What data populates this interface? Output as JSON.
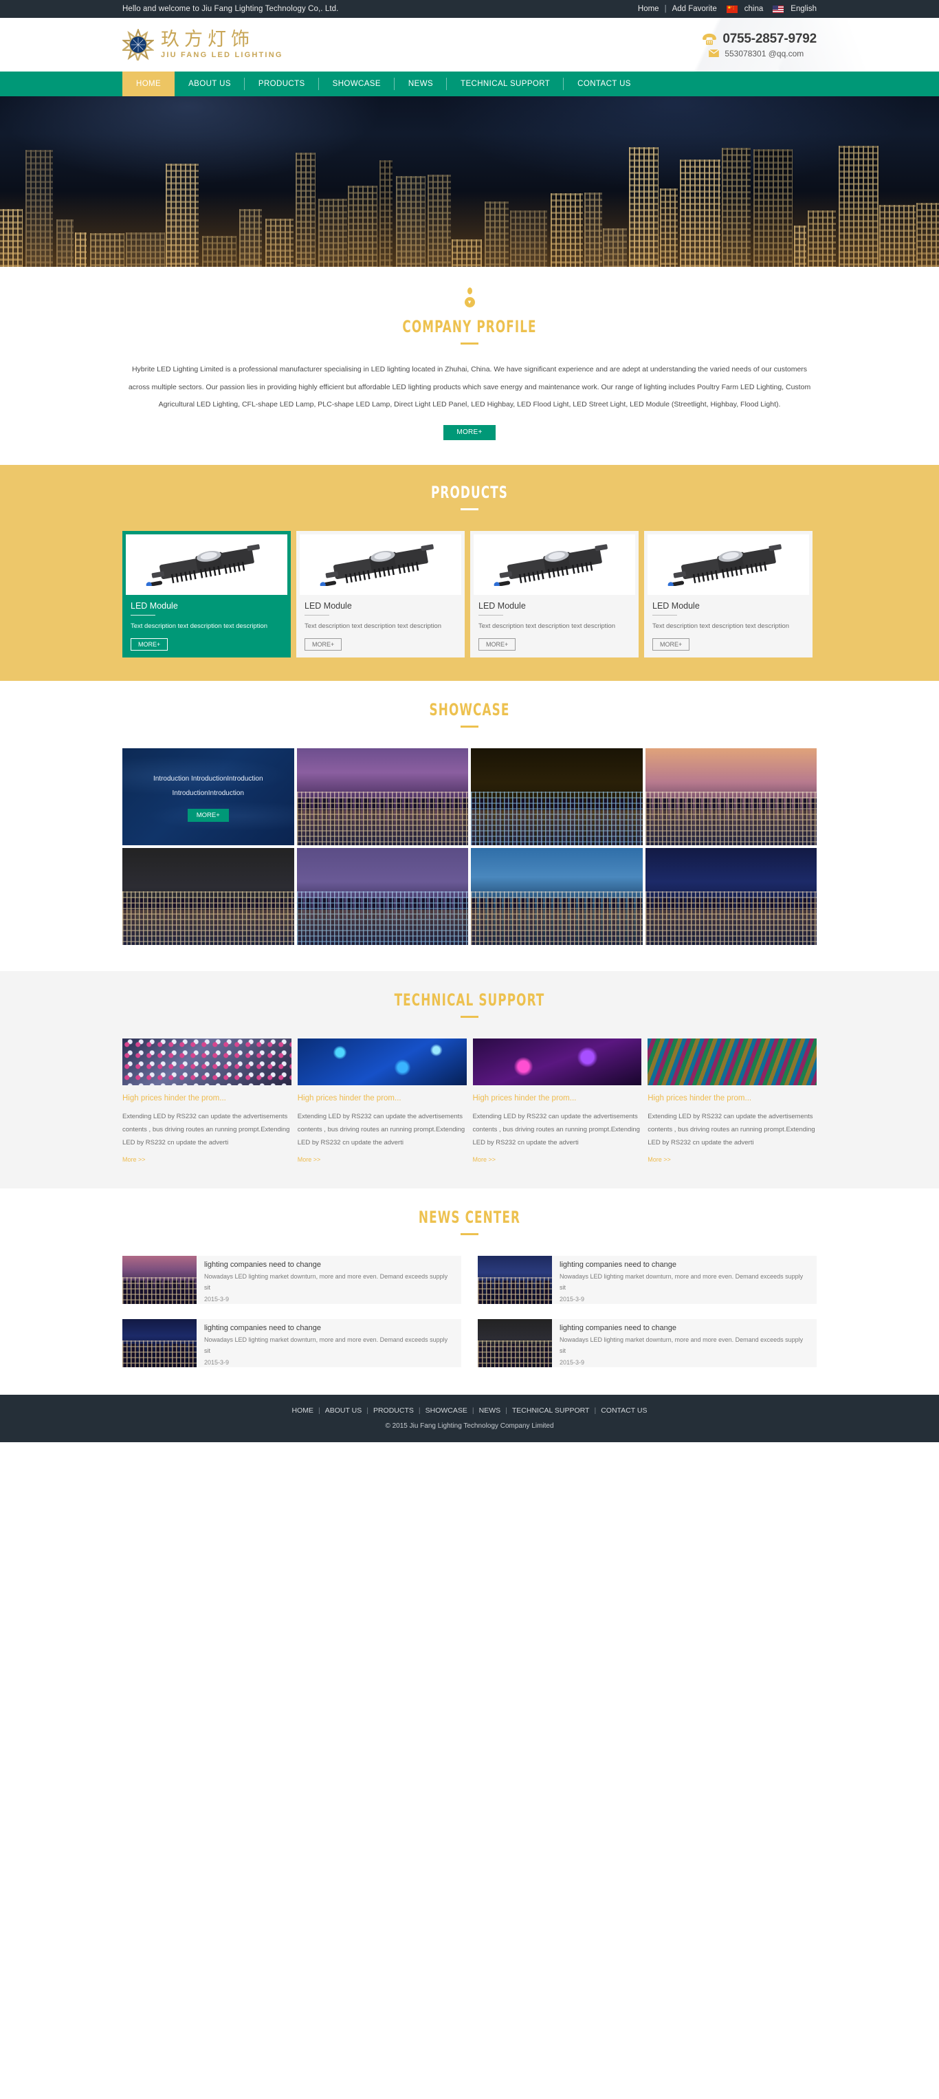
{
  "topbar": {
    "welcome": "Hello and welcome to Jiu Fang Lighting Technology Co,. Ltd.",
    "home": "Home",
    "separator": "|",
    "add_favorite": "Add Favorite",
    "lang_cn": "china",
    "lang_en": "English"
  },
  "header": {
    "logo_cn": "玖方灯饰",
    "logo_en": "JIU FANG LED LIGHTING",
    "phone": "0755-2857-9792",
    "email": "553078301 @qq.com"
  },
  "nav": {
    "items": [
      {
        "label": "HOME",
        "active": true
      },
      {
        "label": "ABOUT US",
        "active": false
      },
      {
        "label": "PRODUCTS",
        "active": false
      },
      {
        "label": "SHOWCASE",
        "active": false
      },
      {
        "label": "NEWS",
        "active": false
      },
      {
        "label": "TECHNICAL SUPPORT",
        "active": false
      },
      {
        "label": "CONTACT US",
        "active": false
      }
    ]
  },
  "profile": {
    "title": "COMPANY PROFILE",
    "body": "Hybrite LED Lighting Limited is a professional manufacturer specialising in LED lighting located in Zhuhai, China. We have significant experience and are adept at understanding the varied needs of our customers across multiple sectors. Our passion lies in providing highly efficient but affordable LED lighting products which save energy and maintenance work. Our range of lighting includes  Poultry Farm LED Lighting, Custom Agricultural LED Lighting, CFL-shape LED Lamp, PLC-shape LED Lamp, Direct Light LED Panel, LED Highbay, LED Flood Light, LED Street Light, LED Module (Streetlight, Highbay, Flood Light).",
    "more_label": "MORE+"
  },
  "products": {
    "title": "PRODUCTS",
    "more_label": "MORE+",
    "items": [
      {
        "name": "LED Module",
        "desc": "Text description text description text description",
        "active": true
      },
      {
        "name": "LED Module",
        "desc": "Text description text description text description",
        "active": false
      },
      {
        "name": "LED Module",
        "desc": "Text description text description text description",
        "active": false
      },
      {
        "name": "LED Module",
        "desc": "Text description text description text description",
        "active": false
      }
    ]
  },
  "showcase": {
    "title": "SHOWCASE",
    "intro_text": "Introduction IntroductionIntroduction IntroductionIntroduction",
    "more_label": "MORE+",
    "tiles": [
      {
        "kind": "intro"
      },
      {
        "kind": "image",
        "style": "cityA"
      },
      {
        "kind": "image",
        "style": "cityB"
      },
      {
        "kind": "image",
        "style": "cityC"
      },
      {
        "kind": "image",
        "style": "cityD"
      },
      {
        "kind": "image",
        "style": "cityE"
      },
      {
        "kind": "image",
        "style": "cityF"
      },
      {
        "kind": "image",
        "style": "cityG"
      }
    ]
  },
  "tech": {
    "title": "TECHNICAL SUPPORT",
    "items": [
      {
        "title": "High prices hinder the prom...",
        "desc": "Extending LED by RS232 can update the advertisements contents , bus driving routes an running prompt.Extending LED by RS232 cn update the adverti",
        "more": "More >>",
        "style": "led1"
      },
      {
        "title": "High prices hinder the prom...",
        "desc": "Extending LED by RS232 can update the advertisements contents , bus driving routes an running prompt.Extending LED by RS232 cn update the adverti",
        "more": "More >>",
        "style": "led2"
      },
      {
        "title": "High prices hinder the prom...",
        "desc": "Extending LED by RS232 can update the advertisements contents , bus driving routes an running prompt.Extending LED by RS232 cn update the adverti",
        "more": "More >>",
        "style": "led3"
      },
      {
        "title": "High prices hinder the prom...",
        "desc": "Extending LED by RS232 can update the advertisements contents , bus driving routes an running prompt.Extending LED by RS232 cn update the adverti",
        "more": "More >>",
        "style": "led4"
      }
    ]
  },
  "news": {
    "title": "NEWS CENTER",
    "items": [
      {
        "title": "lighting companies need to change",
        "summary": "Nowadays LED lighting market downturn, more and more even. Demand exceeds supply sit",
        "date": "2015-3-9",
        "style": "cityH"
      },
      {
        "title": "lighting companies need to change",
        "summary": "Nowadays LED lighting market downturn, more and more even. Demand exceeds supply sit",
        "date": "2015-3-9",
        "style": "cityI"
      },
      {
        "title": "lighting companies need to change",
        "summary": "Nowadays LED lighting market downturn, more and more even. Demand exceeds supply sit",
        "date": "2015-3-9",
        "style": "cityG"
      },
      {
        "title": "lighting companies need to change",
        "summary": "Nowadays LED lighting market downturn, more and more even. Demand exceeds supply sit",
        "date": "2015-3-9",
        "style": "cityD"
      }
    ]
  },
  "footer": {
    "links": [
      "HOME",
      "ABOUT US",
      "PRODUCTS",
      "SHOWCASE",
      "NEWS",
      "TECHNICAL SUPPORT",
      "CONTACT US"
    ],
    "separator": "|",
    "copyright": "© 2015 Jiu Fang Lighting Technology Company Limited"
  },
  "colors": {
    "accent_gold": "#edc14f",
    "accent_green": "#009877",
    "dark": "#252f38",
    "products_bg": "#edc76a"
  }
}
